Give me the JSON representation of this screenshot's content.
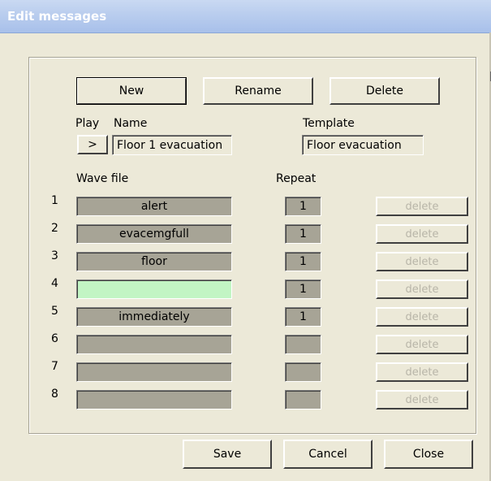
{
  "window": {
    "title": "Edit messages"
  },
  "toolbar": {
    "new_label": "New",
    "rename_label": "Rename",
    "delete_label": "Delete"
  },
  "message": {
    "play_label": "Play",
    "play_button": ">",
    "name_label": "Name",
    "name_value": "Floor 1 evacuation",
    "template_label": "Template",
    "template_value": "Floor evacuation"
  },
  "table": {
    "wave_header": "Wave file",
    "repeat_header": "Repeat",
    "rows": [
      {
        "num": "1",
        "wave": "alert",
        "repeat": "1",
        "delete": "delete"
      },
      {
        "num": "2",
        "wave": "evacemgfull",
        "repeat": "1",
        "delete": "delete"
      },
      {
        "num": "3",
        "wave": "floor",
        "repeat": "1",
        "delete": "delete"
      },
      {
        "num": "4",
        "wave": "",
        "repeat": "1",
        "delete": "delete",
        "active": true
      },
      {
        "num": "5",
        "wave": "immediately",
        "repeat": "1",
        "delete": "delete"
      },
      {
        "num": "6",
        "wave": "",
        "repeat": "",
        "delete": "delete"
      },
      {
        "num": "7",
        "wave": "",
        "repeat": "",
        "delete": "delete"
      },
      {
        "num": "8",
        "wave": "",
        "repeat": "",
        "delete": "delete"
      }
    ]
  },
  "footer": {
    "save_label": "Save",
    "cancel_label": "Cancel",
    "close_label": "Close"
  },
  "colors": {
    "background": "#ece9d8",
    "wave_field": "#a7a496",
    "active_field": "#c2f5c4",
    "titlebar": "#b9cdee"
  }
}
